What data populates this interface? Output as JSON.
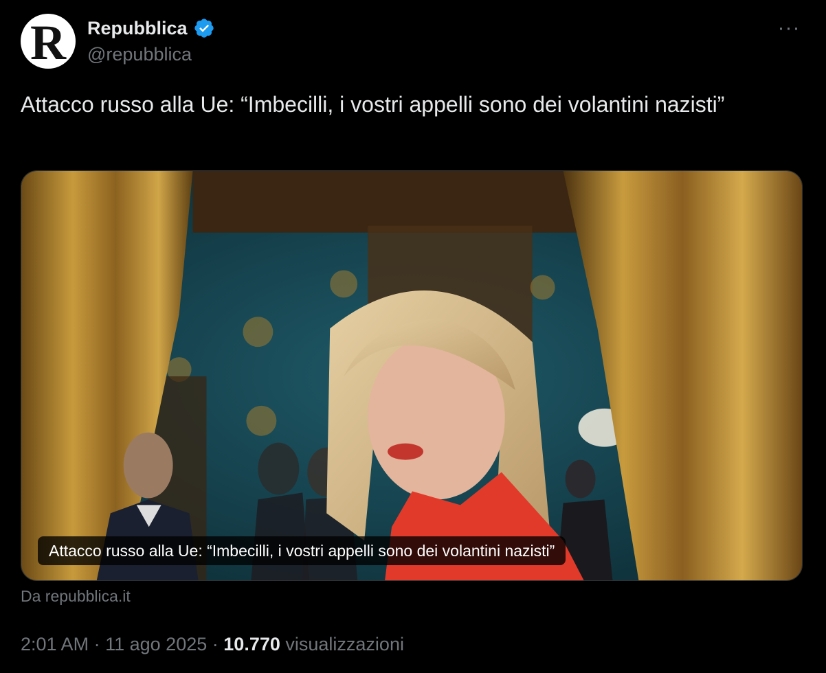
{
  "account": {
    "display_name": "Repubblica",
    "handle": "@repubblica",
    "avatar_letter": "R",
    "verified_icon": "verified-badge-icon",
    "verified_color": "#1d9bf0"
  },
  "more_options": {
    "icon": "more-options-icon",
    "glyph": "···"
  },
  "tweet": {
    "text": "Attacco russo alla Ue: “Imbecilli, i vostri appelli sono dei volantini nazisti”"
  },
  "card": {
    "caption": "Attacco russo alla Ue: “Imbecilli, i vostri appelli sono dei volantini nazisti”",
    "source": "Da repubblica.it"
  },
  "meta": {
    "time": "2:01 AM",
    "separator": "·",
    "date": "11 ago 2025",
    "views": "10.770",
    "views_label": "visualizzazioni"
  },
  "colors": {
    "background": "#000000",
    "text_primary": "#e7e9ea",
    "text_secondary": "#71767b"
  }
}
